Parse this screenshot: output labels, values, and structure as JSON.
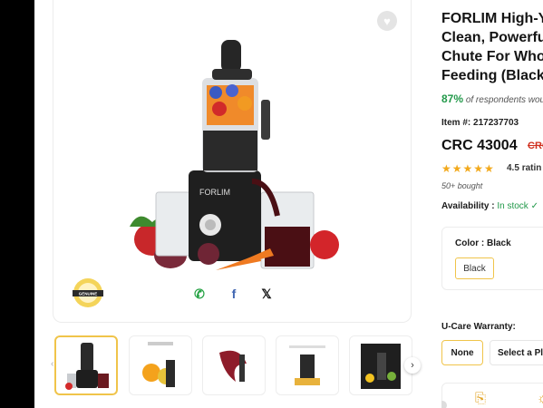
{
  "product": {
    "title_lines": [
      "FORLIM High-Yi",
      "Clean, Powerful",
      "Chute For Whol",
      "Feeding (Black)"
    ],
    "respondents_pct": "87%",
    "respondents_text": "of respondents woul",
    "item_label": "Item #:",
    "item_number": "217237703",
    "price": "CRC 43004",
    "old_price": "CRC",
    "stars": "★★★★★",
    "rating_value": "4.5",
    "rating_text": "ratin",
    "bought": "50+ bought",
    "availability_label": "Availability :",
    "availability_value": "In stock ✓"
  },
  "options": {
    "color_label": "Color : Black",
    "color_selected": "Black",
    "warranty_label": "U-Care Warranty:",
    "warranty_none": "None",
    "warranty_plan": "Select a Pla"
  },
  "gallery": {
    "brand_on_product": "FORLIM",
    "badge_text": "GENUINE",
    "share_icons": [
      "whatsapp-icon",
      "facebook-icon",
      "x-icon"
    ],
    "thumbnail_count": 5,
    "active_thumbnail": 1
  },
  "colors": {
    "accent": "#f0c44a",
    "instock": "#22994a",
    "price_old": "#d0301f",
    "star": "#f2a91c"
  }
}
